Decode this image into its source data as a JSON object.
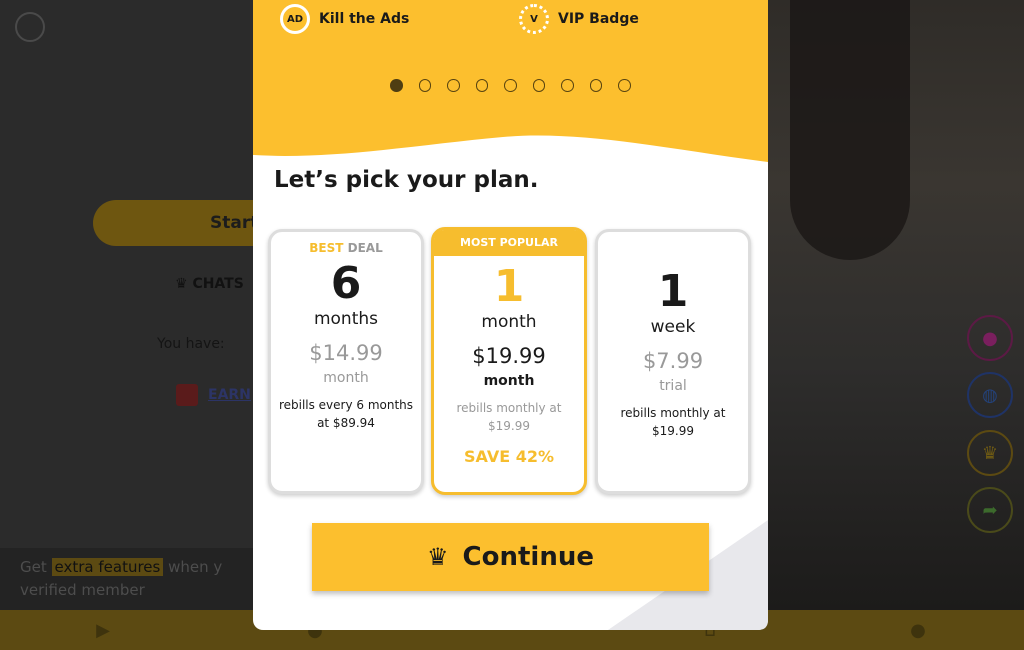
{
  "background": {
    "start_label": "Start",
    "chats_label": "CHATS",
    "you_have_label": "You have:",
    "earn_label": "EARN",
    "promo": {
      "prefix": "Get",
      "highlight": "extra features",
      "suffix": "when y",
      "line2": "verified member"
    }
  },
  "modal": {
    "features": [
      {
        "icon": "no-ads-icon",
        "icon_text": "AD",
        "label": "Kill the Ads"
      },
      {
        "icon": "vip-badge-icon",
        "icon_text": "V",
        "label": "VIP Badge"
      }
    ],
    "carousel": {
      "total": 9,
      "active": 1
    },
    "title": "Let’s pick your plan.",
    "plans": [
      {
        "badge_a": "BEST",
        "badge_b": "DEAL",
        "number": "6",
        "unit": "months",
        "price": "$14.99",
        "per": "month",
        "note": "rebills every 6 months at $89.94"
      },
      {
        "header": "MOST POPULAR",
        "number": "1",
        "unit": "month",
        "price": "$19.99",
        "per": "month",
        "note": "rebills monthly at $19.99",
        "save": "SAVE 42%",
        "selected": true
      },
      {
        "number": "1",
        "unit": "week",
        "price": "$7.99",
        "per": "trial",
        "note": "rebills monthly at $19.99"
      }
    ],
    "continue_label": "Continue"
  },
  "colors": {
    "accent": "#f6bd2e",
    "button": "#fcbf2e"
  }
}
